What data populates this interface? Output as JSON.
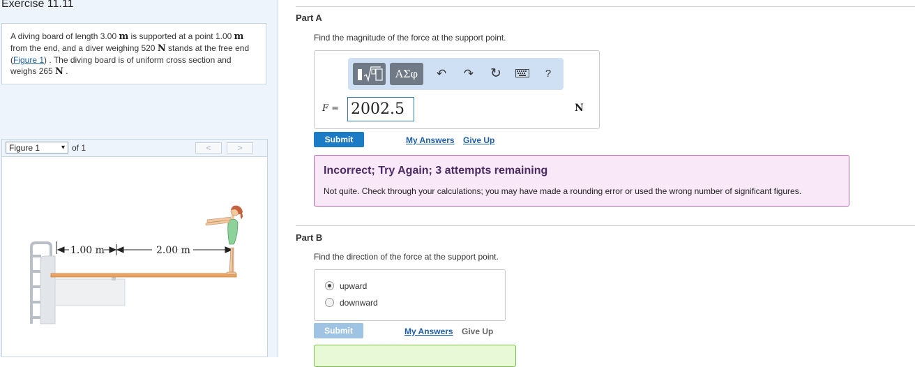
{
  "exercise": {
    "title": "Exercise 11.11"
  },
  "problem": {
    "text1": "A diving board of length 3.00 ",
    "unit_m1": "m",
    "text2": " is supported at a point 1.00 ",
    "unit_m2": "m",
    "text3": " from the end, and a diver weighing 520 ",
    "unit_n1": "N",
    "text4": " stands at the free end (",
    "figure_link": "Figure 1",
    "text5": ") . The diving board is of uniform cross section and weighs 265 ",
    "unit_n2": "N",
    "text6": " ."
  },
  "figure": {
    "select_value": "Figure 1",
    "of_label": "of 1",
    "prev": "<",
    "next": ">",
    "label_1": "1.00 m",
    "label_2": "2.00 m"
  },
  "partA": {
    "title": "Part A",
    "question": "Find the magnitude of the force at the support point.",
    "toolbar": {
      "template_icon": "template-icon",
      "greek": "ΑΣφ",
      "undo": "↶",
      "redo": "↷",
      "reset": "↻",
      "keyboard_icon": "keyboard-icon",
      "help": "?"
    },
    "var_label": "F =",
    "answer_value": "2002.5",
    "unit": "N",
    "submit": "Submit",
    "my_answers": "My Answers",
    "give_up": "Give Up",
    "feedback_title": "Incorrect; Try Again; 3 attempts remaining",
    "feedback_text": "Not quite. Check through your calculations; you may have made a rounding error or used the wrong number of significant figures."
  },
  "partB": {
    "title": "Part B",
    "question": "Find the direction of the force at the support point.",
    "options": [
      {
        "label": "upward",
        "selected": true
      },
      {
        "label": "downward",
        "selected": false
      }
    ],
    "submit": "Submit",
    "my_answers": "My Answers",
    "give_up": "Give Up"
  },
  "colors": {
    "submit_active": "#1b7bc4",
    "submit_disabled": "#9fc3e3",
    "feedback_border": "#b565b0",
    "feedback_bg": "#f9e8f8"
  }
}
